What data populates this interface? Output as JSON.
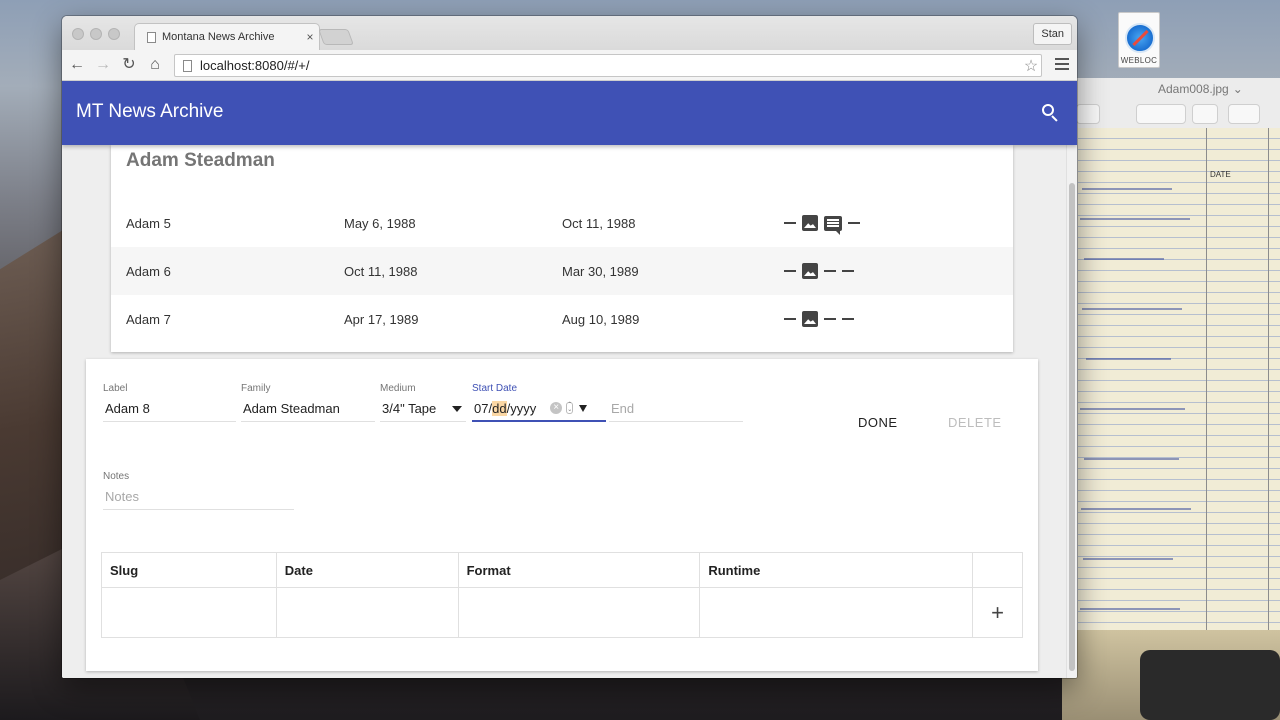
{
  "browser": {
    "tab_title": "Montana News Archive",
    "tab_close": "×",
    "profile": "Stan",
    "url": "localhost:8080/#/+/",
    "star": "☆"
  },
  "desktop": {
    "icon_label": "WEBLOC",
    "preview_title": "Adam008.jpg",
    "ledger_header": "DATE"
  },
  "app": {
    "title": "MT News Archive",
    "family": {
      "name": "Adam Steadman",
      "tapes": [
        {
          "label": "Adam 5",
          "start": "May 6, 1988",
          "end": "Oct 11, 1988",
          "status": [
            "dash",
            "image",
            "comment",
            "dash"
          ]
        },
        {
          "label": "Adam 6",
          "start": "Oct 11, 1988",
          "end": "Mar 30, 1989",
          "status": [
            "dash",
            "image",
            "dash",
            "dash"
          ]
        },
        {
          "label": "Adam 7",
          "start": "Apr 17, 1989",
          "end": "Aug 10, 1989",
          "status": [
            "dash",
            "image",
            "dash",
            "dash"
          ]
        }
      ]
    },
    "form": {
      "label_label": "Label",
      "label_value": "Adam 8",
      "family_label": "Family",
      "family_value": "Adam Steadman",
      "medium_label": "Medium",
      "medium_value": "3/4\" Tape",
      "start_label": "Start Date",
      "start_month": "07",
      "start_sep1": "/",
      "start_day": "dd",
      "start_sep2": "/",
      "start_year": "yyyy",
      "end_placeholder": "End",
      "notes_label": "Notes",
      "notes_placeholder": "Notes",
      "done": "DONE",
      "delete": "DELETE"
    },
    "slug_table": {
      "headers": [
        "Slug",
        "Date",
        "Format",
        "Runtime"
      ],
      "add": "+"
    }
  },
  "colors": {
    "primary": "#3f51b5",
    "focused_date_segment": "#fbd7a4"
  }
}
